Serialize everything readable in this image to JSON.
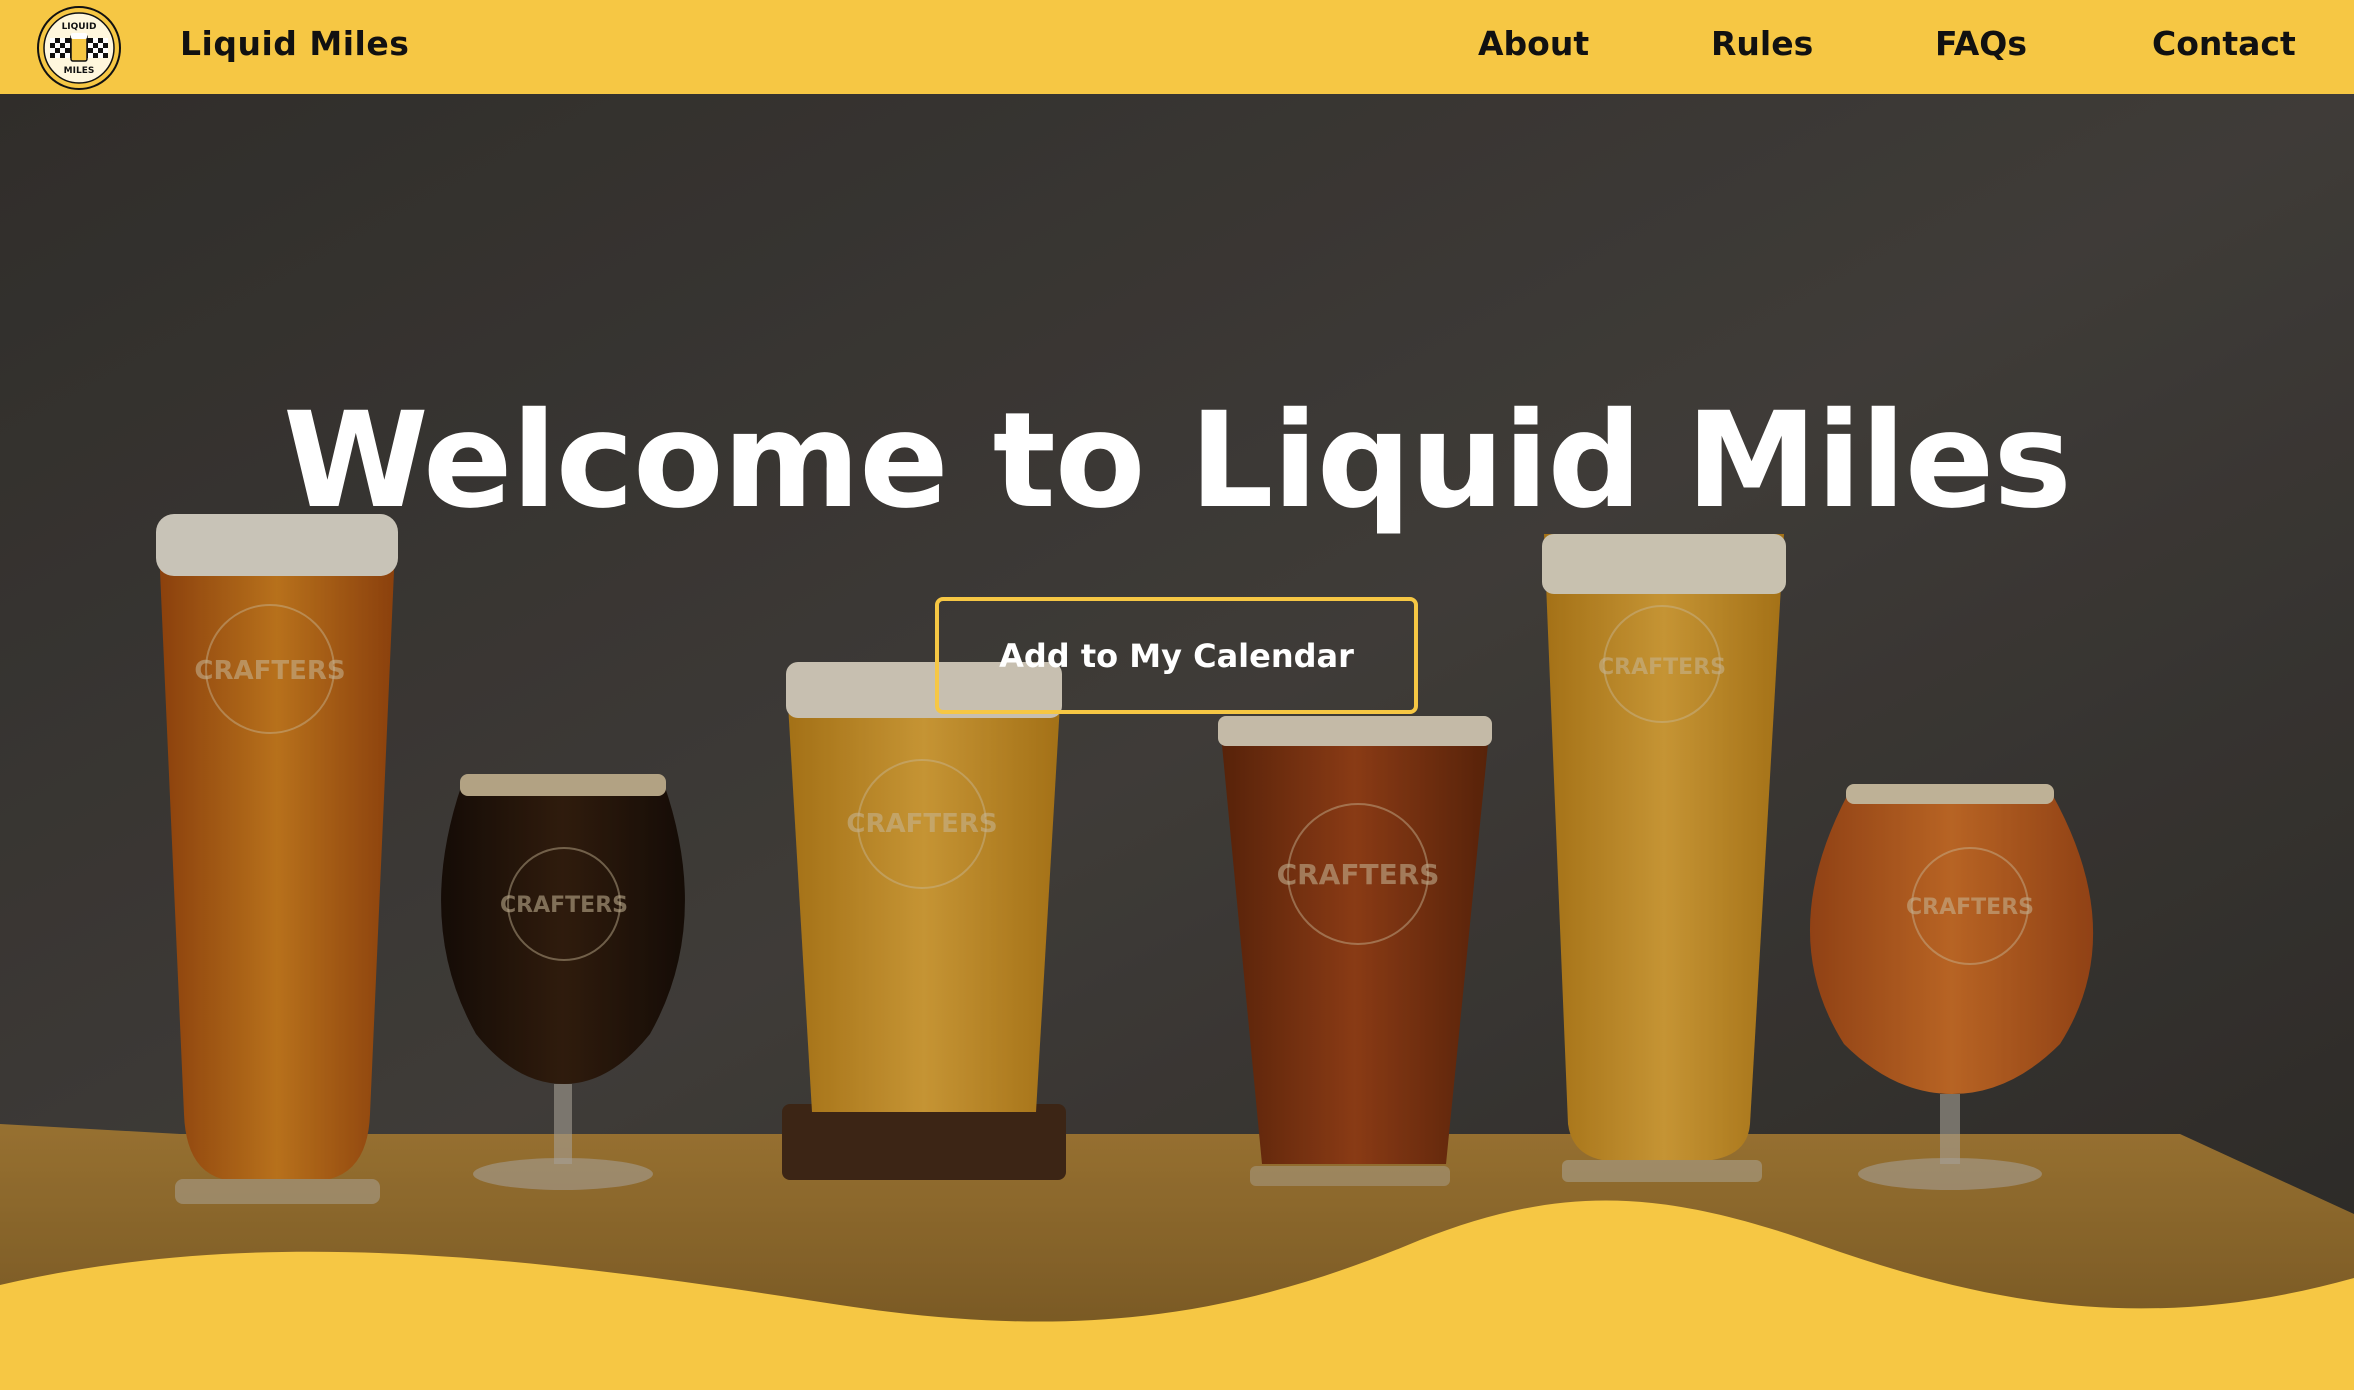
{
  "header": {
    "logo_icon": "liquid-miles-badge-icon",
    "logo_text_top": "LIQUID",
    "logo_text_bottom": "MILES",
    "brand": "Liquid Miles"
  },
  "nav": [
    {
      "label": "About"
    },
    {
      "label": "Rules"
    },
    {
      "label": "FAQs"
    },
    {
      "label": "Contact"
    }
  ],
  "hero": {
    "title": "Welcome to Liquid Miles",
    "cta_label": "Add to My Calendar",
    "glass_print": "CRAFTERS"
  },
  "colors": {
    "accent": "#f6c744",
    "text_dark": "#111111",
    "text_light": "#ffffff"
  }
}
